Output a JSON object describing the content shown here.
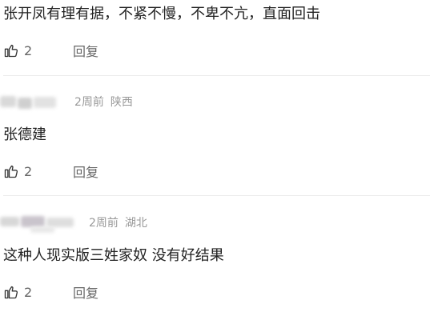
{
  "comments": [
    {
      "text": "张开凤有理有据，不紧不慢，不卑不亢，直面回击",
      "likes": "2",
      "reply_label": "回复"
    },
    {
      "time": "2周前",
      "location": "陕西",
      "text": "张德建",
      "likes": "2",
      "reply_label": "回复"
    },
    {
      "time": "2周前",
      "location": "湖北",
      "text": "这种人现实版三姓家奴 没有好结果",
      "likes": "2",
      "reply_label": "回复"
    }
  ],
  "icons": {
    "like": "thumbs-up-icon"
  },
  "colors": {
    "text": "#222222",
    "meta": "#999999",
    "action": "#666666",
    "divider": "#ececec"
  }
}
